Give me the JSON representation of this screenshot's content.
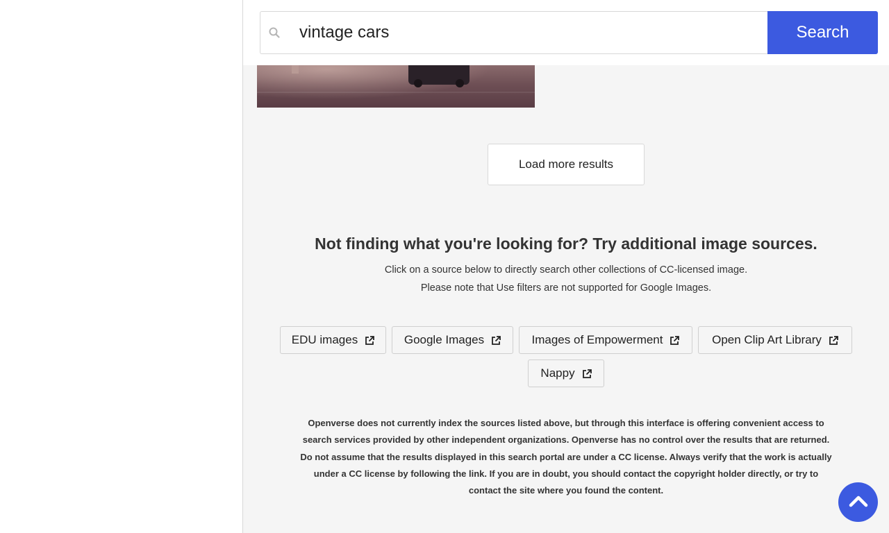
{
  "search": {
    "query": "vintage cars",
    "button_label": "Search"
  },
  "results": {
    "load_more_label": "Load more results"
  },
  "additional_sources": {
    "title": "Not finding what you're looking for? Try additional image sources.",
    "description_line1": "Click on a source below to directly search other collections of CC-licensed image.",
    "description_line2": "Please note that Use filters are not supported for Google Images.",
    "sources": [
      {
        "label": "EDU images"
      },
      {
        "label": "Google Images"
      },
      {
        "label": "Images of Empowerment"
      },
      {
        "label": "Open Clip Art Library"
      },
      {
        "label": "Nappy"
      }
    ],
    "disclaimer": "Openverse does not currently index the sources listed above, but through this interface is offering convenient access to search services provided by other independent organizations. Openverse has no control over the results that are returned. Do not assume that the results displayed in this search portal are under a CC license. Always verify that the work is actually under a CC license by following the link. If you are in doubt, you should contact the copyright holder directly, or try to contact the site where you found the content."
  },
  "icons": {
    "search": "search-icon",
    "external_link": "external-link-icon",
    "scroll_top": "chevron-up-icon"
  },
  "colors": {
    "accent": "#3c5ae0",
    "background": "#f5f5f5"
  }
}
